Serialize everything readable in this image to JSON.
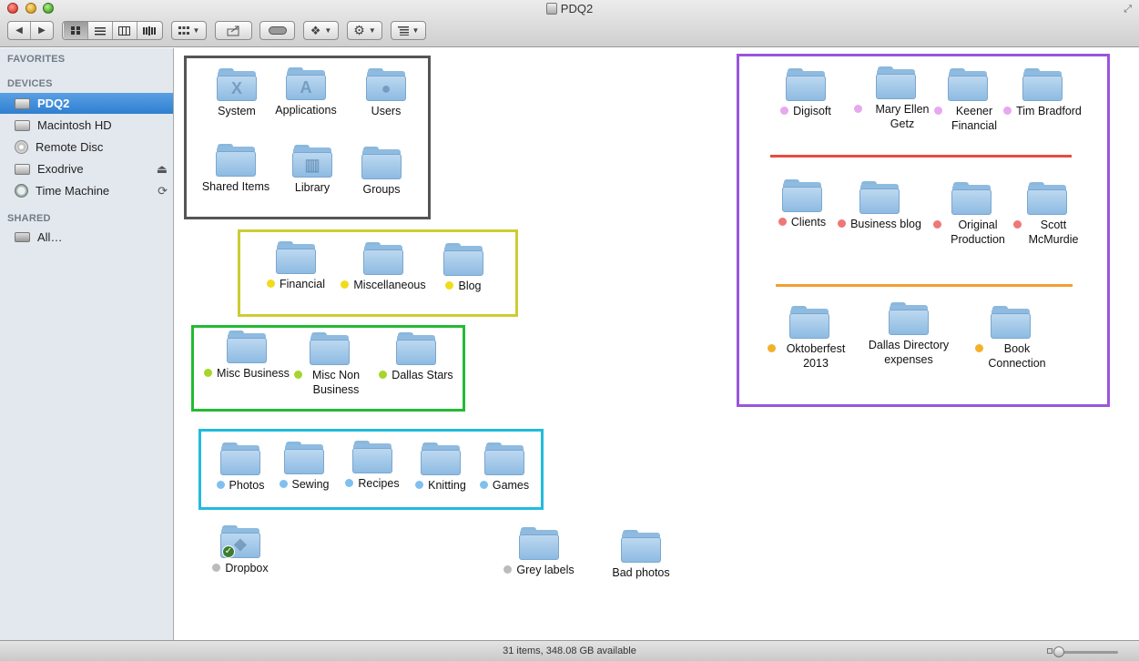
{
  "window": {
    "title": "PDQ2"
  },
  "toolbar": {
    "back": "◀",
    "forward": "▶"
  },
  "sidebar": {
    "favorites_header": "FAVORITES",
    "devices_header": "DEVICES",
    "shared_header": "SHARED",
    "devices": [
      {
        "label": "PDQ2",
        "icon": "drive-icon",
        "selected": true
      },
      {
        "label": "Macintosh HD",
        "icon": "hard-drive-icon"
      },
      {
        "label": "Remote Disc",
        "icon": "disc-icon"
      },
      {
        "label": "Exodrive",
        "icon": "drive-icon",
        "accessory": "⏏"
      },
      {
        "label": "Time Machine",
        "icon": "time-machine-icon",
        "accessory": "⟳"
      }
    ],
    "shared": [
      {
        "label": "All…",
        "icon": "network-icon"
      }
    ]
  },
  "colors": {
    "box_gray": "#555555",
    "box_yellow": "#cccc33",
    "box_green": "#22bb33",
    "box_cyan": "#22bbdd",
    "box_purple": "#9955dd",
    "line_red": "#e84c3d",
    "line_orange": "#f0a030",
    "tag_purple": "#e6a8ee",
    "tag_red": "#ee7777",
    "tag_orange": "#f3b12a",
    "tag_yellow": "#f1dc1c",
    "tag_green": "#a5d62a",
    "tag_blue": "#7fc0ee",
    "tag_gray": "#bbbbbb"
  },
  "items": {
    "system": {
      "label": "System",
      "glyph": "X"
    },
    "applications": {
      "label": "Applications",
      "glyph": "A"
    },
    "users": {
      "label": "Users",
      "glyph": "●"
    },
    "shared_items": {
      "label": "Shared Items"
    },
    "library": {
      "label": "Library",
      "glyph": "▥"
    },
    "groups": {
      "label": "Groups"
    },
    "financial": {
      "label": "Financial",
      "tag": "yellow"
    },
    "miscellaneous": {
      "label": "Miscellaneous",
      "tag": "yellow"
    },
    "blog": {
      "label": "Blog",
      "tag": "yellow"
    },
    "misc_business": {
      "label": "Misc Business",
      "tag": "green"
    },
    "misc_non_business": {
      "label": "Misc Non Business",
      "tag": "green"
    },
    "dallas_stars": {
      "label": "Dallas Stars",
      "tag": "green"
    },
    "photos": {
      "label": "Photos",
      "tag": "blue"
    },
    "sewing": {
      "label": "Sewing",
      "tag": "blue"
    },
    "recipes": {
      "label": "Recipes",
      "tag": "blue"
    },
    "knitting": {
      "label": "Knitting",
      "tag": "blue"
    },
    "games": {
      "label": "Games",
      "tag": "blue"
    },
    "dropbox": {
      "label": "Dropbox",
      "tag": "gray",
      "glyph": "❖",
      "badge": "✓"
    },
    "grey_labels": {
      "label": "Grey labels",
      "tag": "gray"
    },
    "bad_photos": {
      "label": "Bad photos"
    },
    "digisoft": {
      "label": "Digisoft",
      "tag": "purple"
    },
    "mary_ellen_getz": {
      "label": "Mary Ellen Getz",
      "tag": "purple"
    },
    "keener_financial": {
      "label": "Keener Financial",
      "tag": "purple"
    },
    "tim_bradford": {
      "label": "Tim Bradford",
      "tag": "purple"
    },
    "clients": {
      "label": "Clients",
      "tag": "red"
    },
    "business_blog": {
      "label": "Business blog",
      "tag": "red"
    },
    "original_production": {
      "label": "Original Production",
      "tag": "red"
    },
    "scott_mcmurdie": {
      "label": "Scott McMurdie",
      "tag": "red"
    },
    "oktoberfest_2013": {
      "label": "Oktoberfest 2013",
      "tag": "orange"
    },
    "dallas_directory_expenses": {
      "label": "Dallas Directory expenses"
    },
    "book_connection": {
      "label": "Book Connection",
      "tag": "orange"
    }
  },
  "status": {
    "text": "31 items, 348.08 GB available"
  }
}
